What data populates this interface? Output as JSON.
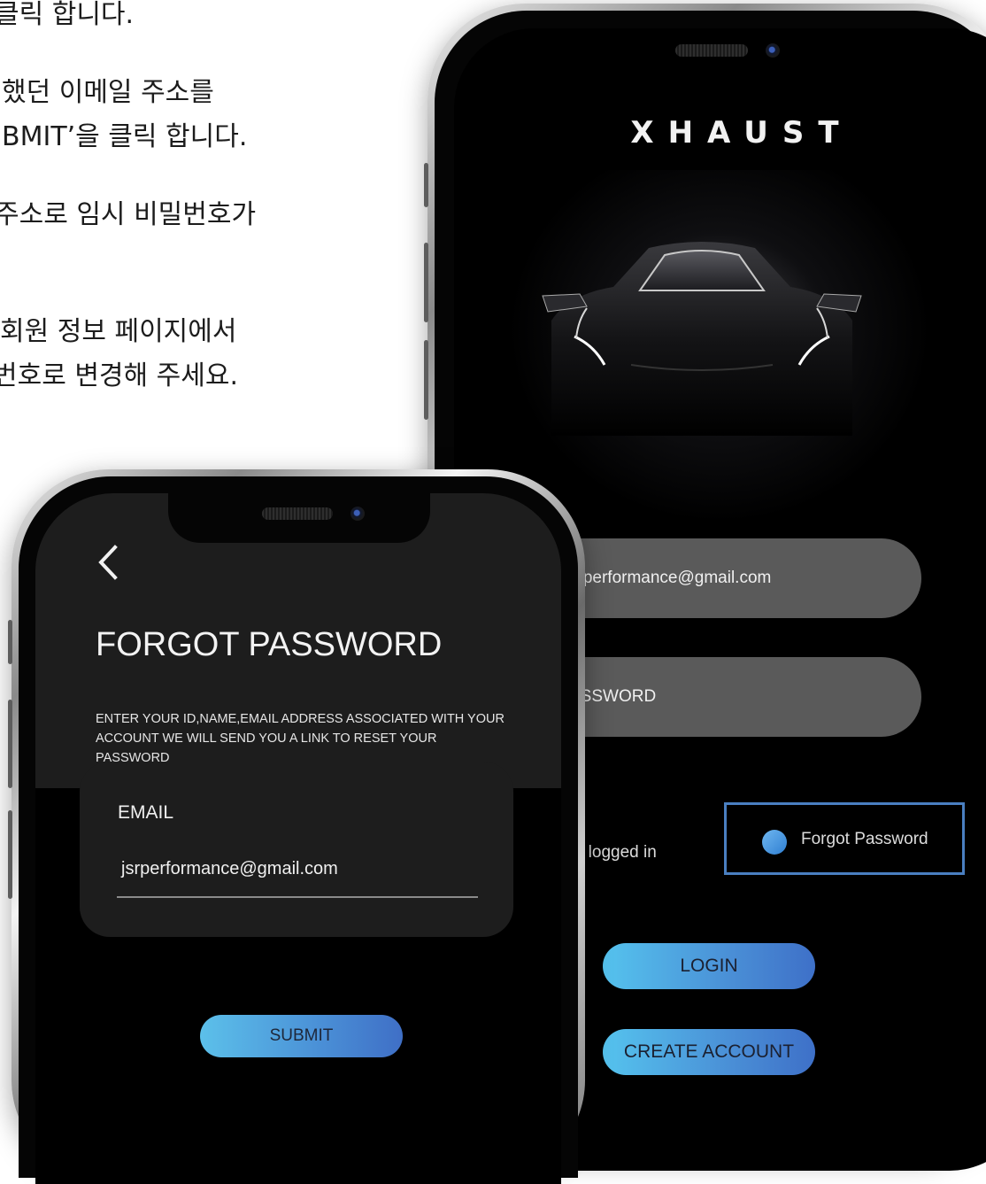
{
  "instructions": {
    "lines": [
      "클릭 합니다.",
      "했던 이메일 주소를",
      "BMIT’을 클릭 합니다.",
      "주소로 임시 비밀번호가",
      "회원 정보 페이지에서",
      "번호로 변경해 주세요."
    ]
  },
  "login_screen": {
    "logo": "XHAUST",
    "email_value": "srperformance@gmail.com",
    "password_placeholder": "ASSWORD",
    "remember_label": "me logged in",
    "forgot_label": "Forgot Password",
    "login_button": "LOGIN",
    "create_account_button": "CREATE ACCOUNT",
    "highlight_color": "#4a7fc1",
    "button_gradient": [
      "#55c3ee",
      "#3e70c8"
    ]
  },
  "forgot_screen": {
    "back_icon": "chevron-left-icon",
    "title": "FORGOT PASSWORD",
    "description": "ENTER YOUR ID,NAME,EMAIL ADDRESS ASSOCIATED WITH YOUR ACCOUNT WE WILL SEND YOU A LINK TO RESET YOUR PASSWORD",
    "email_label": "EMAIL",
    "email_value": "jsrperformance@gmail.com",
    "submit_button": "SUBMIT"
  }
}
